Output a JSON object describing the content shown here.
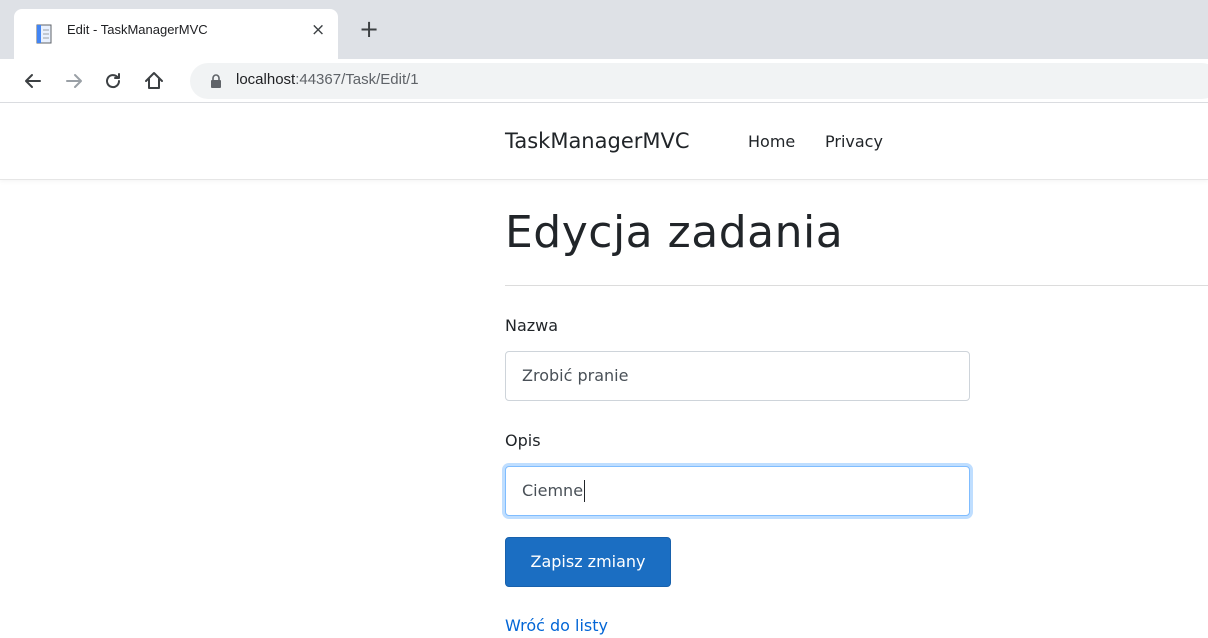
{
  "browser": {
    "tab_title": "Edit - TaskManagerMVC",
    "tab_close": "×",
    "new_tab": "+",
    "url_host": "localhost",
    "url_path": ":44367/Task/Edit/1"
  },
  "site": {
    "brand": "TaskManagerMVC",
    "nav": [
      "Home",
      "Privacy"
    ]
  },
  "page": {
    "title": "Edycja zadania",
    "name_label": "Nazwa",
    "name_value": "Zrobić pranie",
    "desc_label": "Opis",
    "desc_value": "Ciemne",
    "submit_label": "Zapisz zmiany",
    "back_label": "Wróć do listy"
  },
  "colors": {
    "primary_button": "#1b6ec2",
    "link": "#0366d6",
    "focus_border": "#80bdff"
  }
}
